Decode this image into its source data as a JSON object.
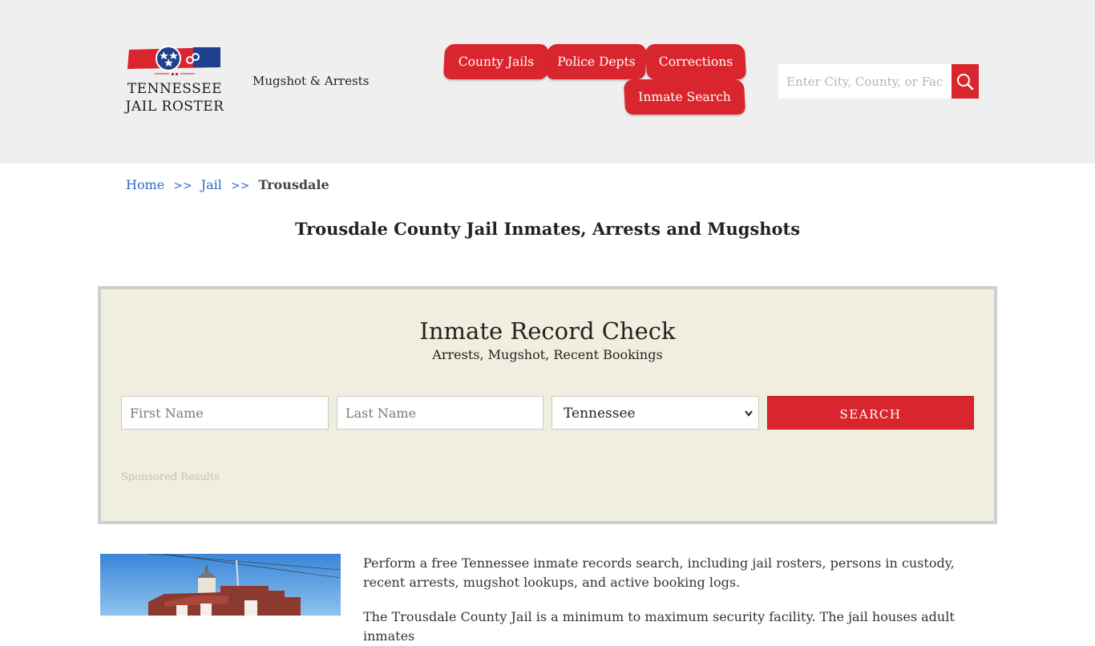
{
  "header": {
    "logo": {
      "line1": "TENNESSEE",
      "line2": "JAIL ROSTER"
    },
    "tagline": "Mugshot & Arrests",
    "nav": [
      {
        "label": "County Jails"
      },
      {
        "label": "Police Depts"
      },
      {
        "label": "Corrections"
      },
      {
        "label": "Inmate Search"
      }
    ],
    "search": {
      "placeholder": "Enter City, County, or Facility"
    },
    "colors": {
      "accent": "#d9262e",
      "header_bg": "#efefef"
    }
  },
  "breadcrumb": {
    "items": [
      "Home",
      "Jail"
    ],
    "separator": ">>",
    "current": "Trousdale"
  },
  "page_title": "Trousdale County Jail Inmates, Arrests and Mugshots",
  "record_check": {
    "title": "Inmate Record Check",
    "subtitle": "Arrests, Mugshot, Recent Bookings",
    "first_name_placeholder": "First Name",
    "last_name_placeholder": "Last Name",
    "state_selected": "Tennessee",
    "submit_label": "SEARCH",
    "sponsored": "Sponsored Results",
    "colors": {
      "panel_bg": "#f0eedf",
      "border": "#cfcfcf"
    }
  },
  "content": {
    "intro": "Perform a free Tennessee inmate records search, including jail rosters, persons in custody, recent arrests, mugshot lookups, and active booking logs.",
    "intro2": "The Trousdale County Jail is a minimum to maximum security facility. The jail houses adult inmates"
  }
}
